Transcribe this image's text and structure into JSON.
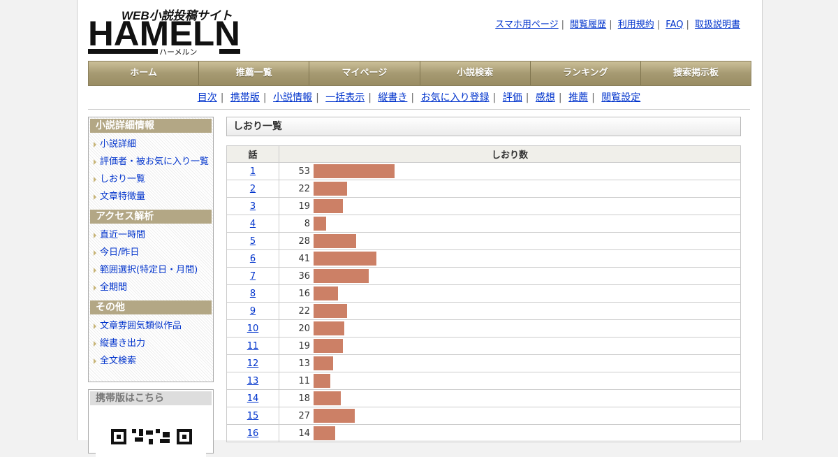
{
  "site": {
    "logo_main": "HAMELN",
    "logo_tagline": "WEB小説投稿サイト",
    "logo_kana": "ハーメルン"
  },
  "toplinks": [
    "スマホ用ページ",
    "閲覧履歴",
    "利用規約",
    "FAQ",
    "取扱説明書"
  ],
  "gnav": [
    "ホーム",
    "推薦一覧",
    "マイページ",
    "小説検索",
    "ランキング",
    "捜索掲示板"
  ],
  "snav": [
    "目次",
    "携帯版",
    "小説情報",
    "一括表示",
    "縦書き",
    "お気に入り登録",
    "評価",
    "感想",
    "推薦",
    "閲覧設定"
  ],
  "sidebar": {
    "sections": [
      {
        "title": "小説詳細情報",
        "items": [
          "小説詳細",
          "評価者・被お気に入り一覧",
          "しおり一覧",
          "文章特徴量"
        ]
      },
      {
        "title": "アクセス解析",
        "items": [
          "直近一時間",
          "今日/昨日",
          "範囲選択(特定日・月間)",
          "全期間"
        ]
      },
      {
        "title": "その他",
        "items": [
          "文章雰囲気類似作品",
          "縦書き出力",
          "全文検索"
        ]
      }
    ],
    "mobile_title": "携帯版はこちら"
  },
  "main": {
    "title": "しおり一覧",
    "col_episode": "話",
    "col_count": "しおり数"
  },
  "chart_data": {
    "type": "bar",
    "categories": [
      "1",
      "2",
      "3",
      "4",
      "5",
      "6",
      "7",
      "8",
      "9",
      "10",
      "11",
      "12",
      "13",
      "14",
      "15",
      "16"
    ],
    "values": [
      53,
      22,
      19,
      8,
      28,
      41,
      36,
      16,
      22,
      20,
      19,
      13,
      11,
      18,
      27,
      14
    ],
    "title": "",
    "xlabel": "話",
    "ylabel": "しおり数",
    "color": "#cc8066"
  }
}
